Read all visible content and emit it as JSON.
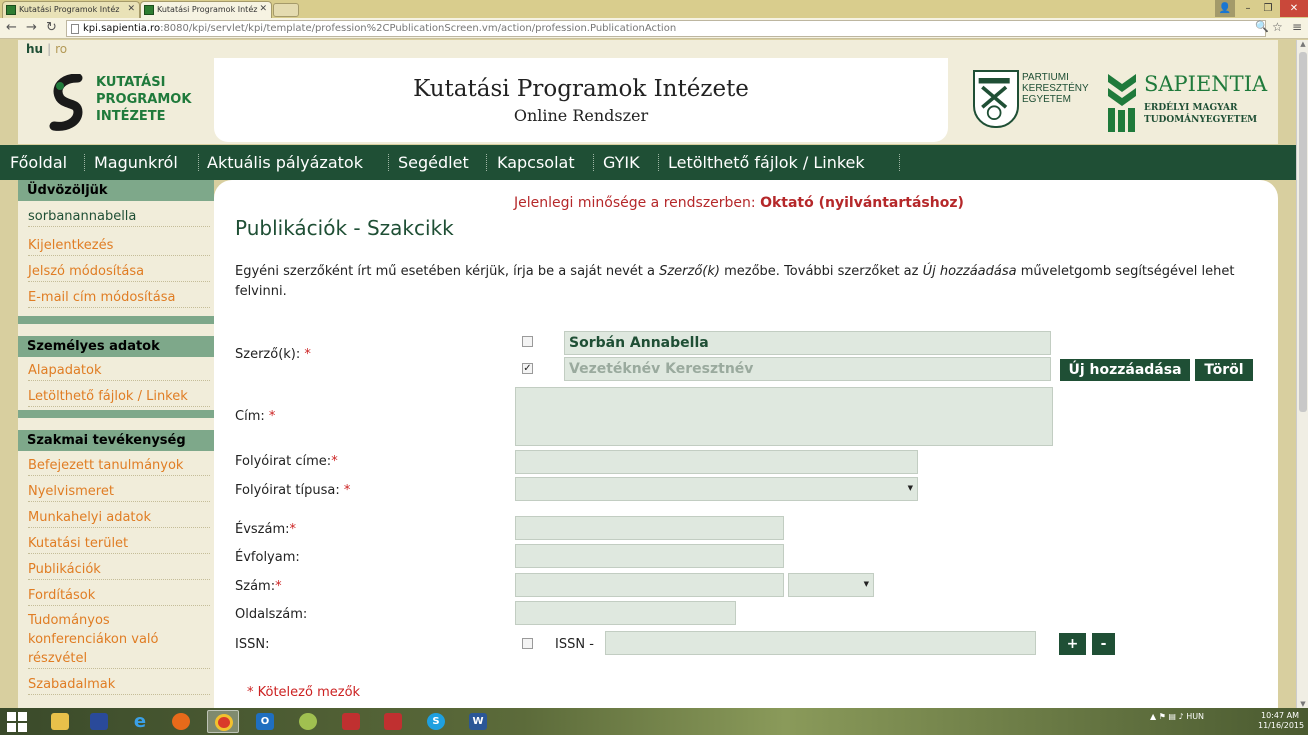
{
  "browser": {
    "tabs": [
      {
        "label": "Kutatási Programok Intéz",
        "active": false
      },
      {
        "label": "Kutatási Programok Intéz",
        "active": true
      }
    ],
    "url_host": "kpi.sapientia.ro",
    "url_rest": ":8080/kpi/servlet/kpi/template/profession%2CPublicationScreen.vm/action/profession.PublicationAction"
  },
  "lang": {
    "hu": "hu",
    "ro": "ro",
    "sep": "|"
  },
  "header": {
    "kpi_logo_lines": [
      "KUTATÁSI",
      "PROGRAMOK",
      "INTÉZETE"
    ],
    "title": "Kutatási Programok Intézete",
    "subtitle": "Online Rendszer",
    "partium_lines": [
      "PARTIUMI",
      "KERESZTÉNY",
      "EGYETEM"
    ],
    "sapientia_title": "SAPIENTIA",
    "sapientia_sub": [
      "ERDÉLYI MAGYAR",
      "TUDOMÁNYEGYETEM"
    ]
  },
  "nav": [
    "Főoldal",
    "Magunkról",
    "Aktuális pályázatok",
    "Segédlet",
    "Kapcsolat",
    "GYIK",
    "Letölthető fájlok / Linkek"
  ],
  "sidebar": {
    "welcome_title": "Üdvözöljük",
    "username": "sorbanannabella",
    "account_links": [
      "Kijelentkezés",
      "Jelszó módosítása",
      "E-mail cím módosítása"
    ],
    "personal_title": "Személyes adatok",
    "personal_links": [
      "Alapadatok",
      "Letölthető fájlok / Linkek"
    ],
    "prof_title": "Szakmai tevékenység",
    "prof_links": [
      "Befejezett tanulmányok",
      "Nyelvismeret",
      "Munkahelyi adatok",
      "Kutatási terület",
      "Publikációk",
      "Fordítások",
      "Tudományos konferenciákon való részvétel",
      "Szabadalmak"
    ]
  },
  "content": {
    "role_prefix": "Jelenlegi minősége a rendszerben: ",
    "role": "Oktató (nyilvántartáshoz)",
    "title": "Publikációk - Szakcikk",
    "intro_1": "Egyéni szerzőként írt mű esetében kérjük, írja be a saját nevét a ",
    "intro_em1": "Szerző(k)",
    "intro_2": " mezőbe. További szerzőket az ",
    "intro_em2": "Új hozzáadása",
    "intro_3": " műveletgomb segítségével lehet felvinni."
  },
  "form": {
    "author_label": "Szerző(k):",
    "author_1_value": "Sorbán  Annabella",
    "author_2_placeholder": "Vezetéknév Keresztnév",
    "add_button": "Új hozzáadása",
    "delete_button": "Töröl",
    "title_label": "Cím:",
    "journal_title_label": "Folyóirat címe:",
    "journal_type_label": "Folyóirat típusa:",
    "year_label": "Évszám:",
    "volume_label": "Évfolyam:",
    "number_label": "Szám:",
    "pages_label": "Oldalszám:",
    "issn_label": "ISSN:",
    "issn_prefix": "ISSN -",
    "plus_button": "+",
    "minus_button": "-",
    "required_mark": "*",
    "required_note": "* Kötelező mezők"
  },
  "taskbar": {
    "tray_lang": "HUN",
    "clock_time": "10:47 AM",
    "clock_date": "11/16/2015"
  }
}
